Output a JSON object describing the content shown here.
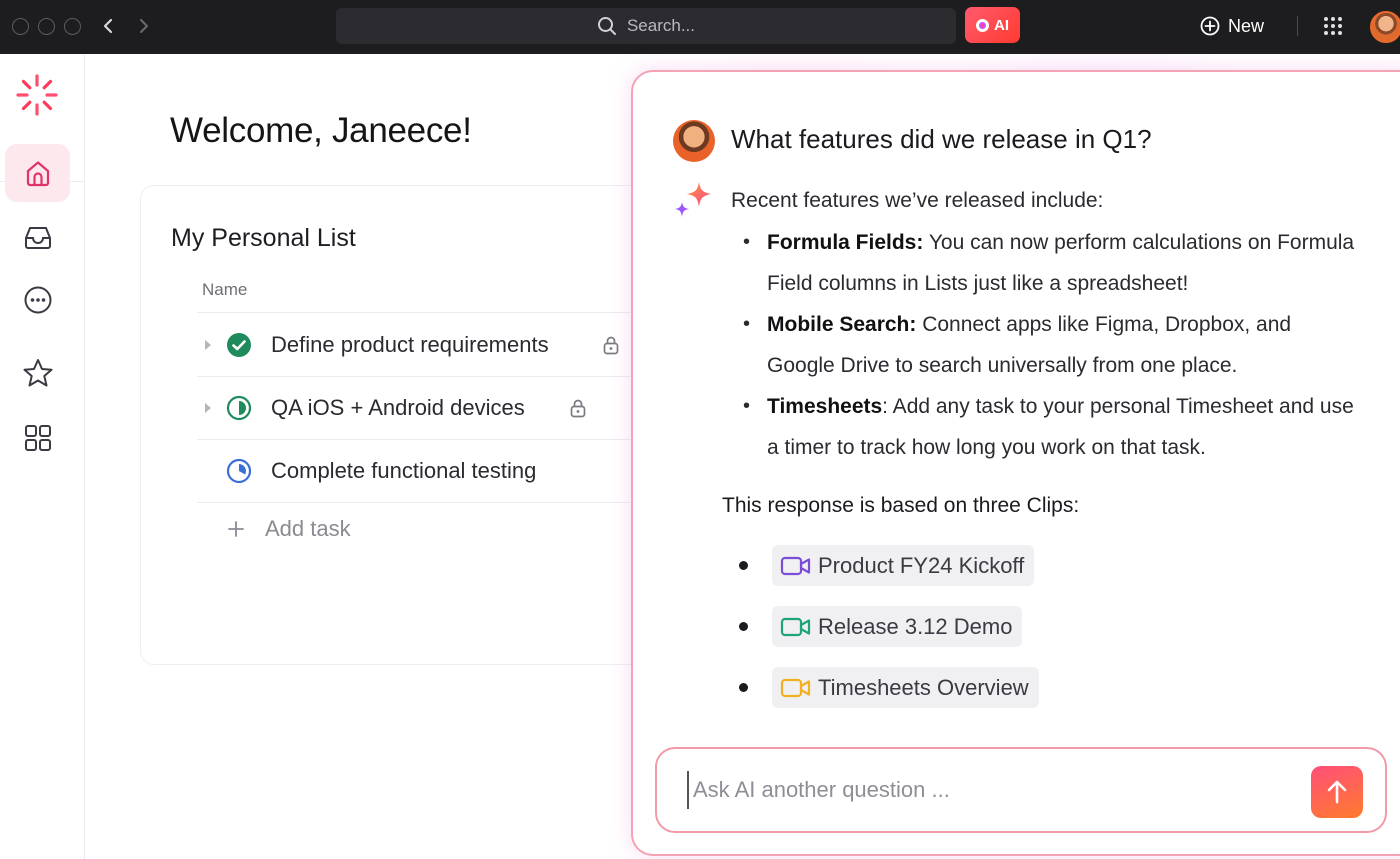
{
  "topbar": {
    "search_placeholder": "Search...",
    "ai_label": "AI",
    "new_label": "New"
  },
  "main": {
    "welcome": "Welcome, Janeece!",
    "list_title": "My Personal List",
    "column_name": "Name",
    "tasks": [
      {
        "label": "Define product requirements",
        "status": "complete",
        "locked": true
      },
      {
        "label": "QA iOS + Android devices",
        "status": "in-progress",
        "locked": true
      },
      {
        "label": "Complete functional testing",
        "status": "in-progress",
        "locked": false
      }
    ],
    "add_task": "Add task"
  },
  "ai_panel": {
    "question": "What features did we release in Q1?",
    "intro": "Recent features we’ve released include:",
    "features": [
      {
        "title": "Formula Fields:",
        "text": " You can now perform calculations on Formula Field columns in Lists just like a spreadsheet!"
      },
      {
        "title": "Mobile Search:",
        "text": " Connect apps like Figma, Dropbox, and Google Drive to search universally from one place."
      },
      {
        "title": "Timesheets",
        "text": ": Add any task to your personal Timesheet and use a timer to track how long you work on that task."
      }
    ],
    "based_on": "This response is based on three Clips:",
    "clips": [
      {
        "label": "Product FY24 Kickoff",
        "color": "#7b4dd6"
      },
      {
        "label": "Release 3.12 Demo",
        "color": "#1fa37a"
      },
      {
        "label": "Timesheets Overview",
        "color": "#f2b01e"
      }
    ],
    "ask_placeholder": "Ask AI another question ..."
  },
  "colors": {
    "accent": "#ff4f7a",
    "complete": "#1f8a5b",
    "progress_green": "#1f8a5b",
    "progress_blue": "#3b6fd8"
  }
}
